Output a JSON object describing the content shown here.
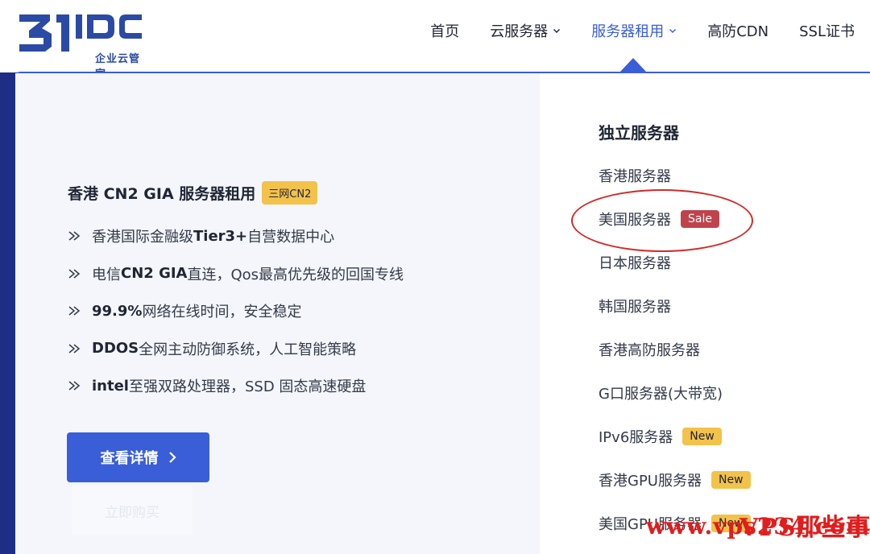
{
  "logo": {
    "main": "31IDC",
    "sub": "企业云管家"
  },
  "nav": {
    "items": [
      {
        "label": "首页",
        "has_chevron": false,
        "active": false
      },
      {
        "label": "云服务器",
        "has_chevron": true,
        "active": false
      },
      {
        "label": "服务器租用",
        "has_chevron": true,
        "active": true
      },
      {
        "label": "高防CDN",
        "has_chevron": false,
        "active": false
      },
      {
        "label": "SSL证书",
        "has_chevron": false,
        "active": false
      }
    ]
  },
  "featured": {
    "title": "香港 CN2 GIA 服务器租用",
    "badge": "三网CN2",
    "features": [
      {
        "pre": "香港国际金融级 ",
        "bold": "Tier3+",
        "post": " 自营数据中心"
      },
      {
        "pre": "电信 ",
        "bold": "CN2 GIA",
        "post": " 直连，Qos最高优先级的回国专线"
      },
      {
        "pre": "",
        "bold": "99.9%",
        "post": " 网络在线时间，安全稳定"
      },
      {
        "pre": "",
        "bold": "DDOS",
        "post": " 全网主动防御系统，人工智能策略"
      },
      {
        "pre": "",
        "bold": "intel",
        "post": "至强双路处理器，SSD 固态高速硬盘"
      }
    ],
    "button_label": "查看详情",
    "ghost_button_label": "立即购买"
  },
  "menu": {
    "title": "独立服务器",
    "items": [
      {
        "label": "香港服务器",
        "tag": "",
        "tag_type": ""
      },
      {
        "label": "美国服务器",
        "tag": "Sale",
        "tag_type": "sale"
      },
      {
        "label": "日本服务器",
        "tag": "",
        "tag_type": ""
      },
      {
        "label": "韩国服务器",
        "tag": "",
        "tag_type": ""
      },
      {
        "label": "香港高防服务器",
        "tag": "",
        "tag_type": ""
      },
      {
        "label": "G口服务器(大带宽)",
        "tag": "",
        "tag_type": ""
      },
      {
        "label": "IPv6服务器",
        "tag": "New",
        "tag_type": "new"
      },
      {
        "label": "香港GPU服务器",
        "tag": "New",
        "tag_type": "new"
      },
      {
        "label": "美国GPU服务器",
        "tag": "New",
        "tag_type": "new"
      }
    ]
  },
  "watermark": {
    "url": "www.vps234.com",
    "cn": "VPS那些事"
  },
  "colors": {
    "accent": "#3a5ed8",
    "badge_yellow": "#f3c24b",
    "sale_red": "#c0434b",
    "annotation_red": "#d22b2b",
    "band_blue": "#26359a"
  },
  "icons": {
    "feature_bullet": "double-chevron-right-icon",
    "nav_dropdown": "chevron-down-icon",
    "button_arrow": "chevron-right-icon"
  }
}
